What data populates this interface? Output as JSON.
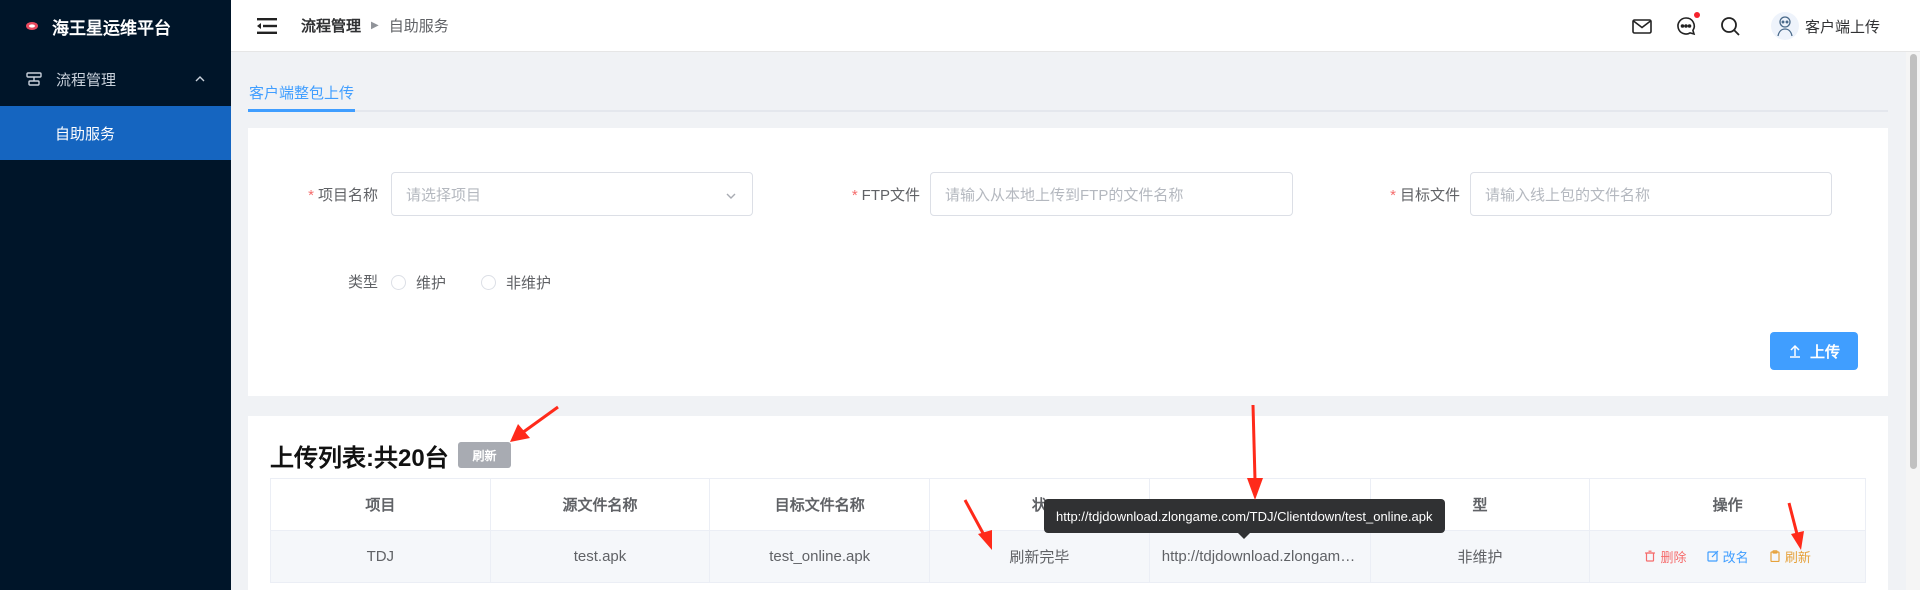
{
  "sidebar": {
    "brand": "海王星运维平台",
    "group_label": "流程管理",
    "active_item": "自助服务"
  },
  "header": {
    "crumb_1": "流程管理",
    "crumb_sep": "▶",
    "crumb_2": "自助服务",
    "username": "客户端上传",
    "icons": [
      "mail-icon",
      "chat-icon",
      "search-icon"
    ]
  },
  "tabs": {
    "active": "客户端整包上传"
  },
  "form": {
    "project_label": "项目名称",
    "project_placeholder": "请选择项目",
    "ftp_label": "FTP文件",
    "ftp_placeholder": "请输入从本地上传到FTP的文件名称",
    "target_label": "目标文件",
    "target_placeholder": "请输入线上包的文件名称",
    "type_label": "类型",
    "type_options": [
      "维护",
      "非维护"
    ],
    "upload_button": "上传",
    "required_mark": "*"
  },
  "list": {
    "title": "上传列表:共20台",
    "refresh_button": "刷新",
    "columns": [
      "项目",
      "源文件名称",
      "目标文件名称",
      "状",
      "",
      "型",
      "操作"
    ],
    "rows": [
      {
        "project": "TDJ",
        "source": "test.apk",
        "target": "test_online.apk",
        "status": "刷新完毕",
        "url": "http://tdjdownload.zlongame.com/TDJ/Clientdown/test_online.apk",
        "type": "非维护"
      }
    ],
    "ops": {
      "delete": "删除",
      "rename": "改名",
      "refresh": "刷新"
    },
    "tooltip": "http://tdjdownload.zlongame.com/TDJ/Clientdown/test_online.apk"
  },
  "colors": {
    "sidebar_bg": "#001529",
    "active_menu": "#1565c0",
    "primary": "#409eff",
    "danger": "#f56c6c",
    "warning": "#e6a23c",
    "annotation_arrow": "#ff2a1a"
  }
}
